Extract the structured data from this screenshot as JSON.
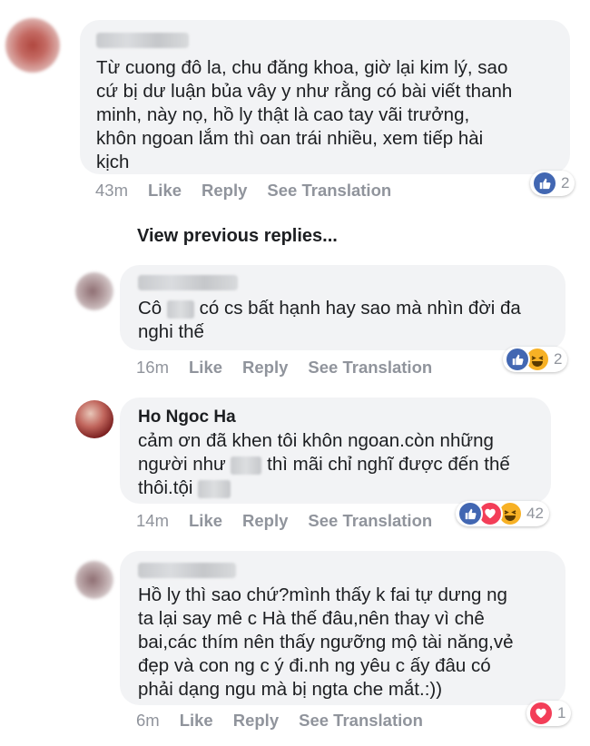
{
  "comments": [
    {
      "text": "Từ cuong đô la, chu đăng khoa, giờ lại kim lý, sao\ncứ bị dư luận bủa vây y như rằng có bài viết thanh\nminh, này nọ, hồ ly thật là cao tay vãi trưởng,\nkhôn ngoan lắm thì oan trái nhiều, xem tiếp hài\nkịch",
      "time": "43m",
      "like": "Like",
      "reply": "Reply",
      "translate": "See Translation",
      "reactions": [
        "like-icon"
      ],
      "reaction_count": "2"
    },
    {
      "text_before": "Cô",
      "text_after": "có cs bất hạnh hay sao mà nhìn đời đa",
      "text_line2": "nghi thế",
      "time": "16m",
      "like": "Like",
      "reply": "Reply",
      "translate": "See Translation",
      "reactions": [
        "like-icon",
        "haha-icon"
      ],
      "reaction_count": "2"
    },
    {
      "author": "Ho Ngoc Ha",
      "line1": "cảm ơn đã khen tôi khôn ngoan.còn những",
      "line2_before": "người như",
      "line2_after": "thì mãi chỉ nghĩ được đến thế",
      "line3": "thôi.tội",
      "time": "14m",
      "like": "Like",
      "reply": "Reply",
      "translate": "See Translation",
      "reactions": [
        "like-icon",
        "love-icon",
        "haha-icon"
      ],
      "reaction_count": "42"
    },
    {
      "text": "Hồ ly thì sao chứ?mình thấy k fai tự dưng ng\nta lại say mê c Hà thế đâu,nên thay vì chê\nbai,các thím nên thấy ngưỡng mộ tài năng,vẻ\nđẹp và con ng c ý đi.nh ng yêu c ấy đâu có\nphải dạng ngu mà bị ngta che mắt.:))",
      "time": "6m",
      "like": "Like",
      "reply": "Reply",
      "translate": "See Translation",
      "reactions": [
        "love-icon"
      ],
      "reaction_count": "1"
    }
  ],
  "view_previous": "View previous replies...",
  "colors": {
    "like": "#4267b2",
    "love": "#f33e58",
    "haha": "#f7b125",
    "link": "#365899",
    "meta": "#90949c",
    "bubble": "#f2f3f5"
  }
}
